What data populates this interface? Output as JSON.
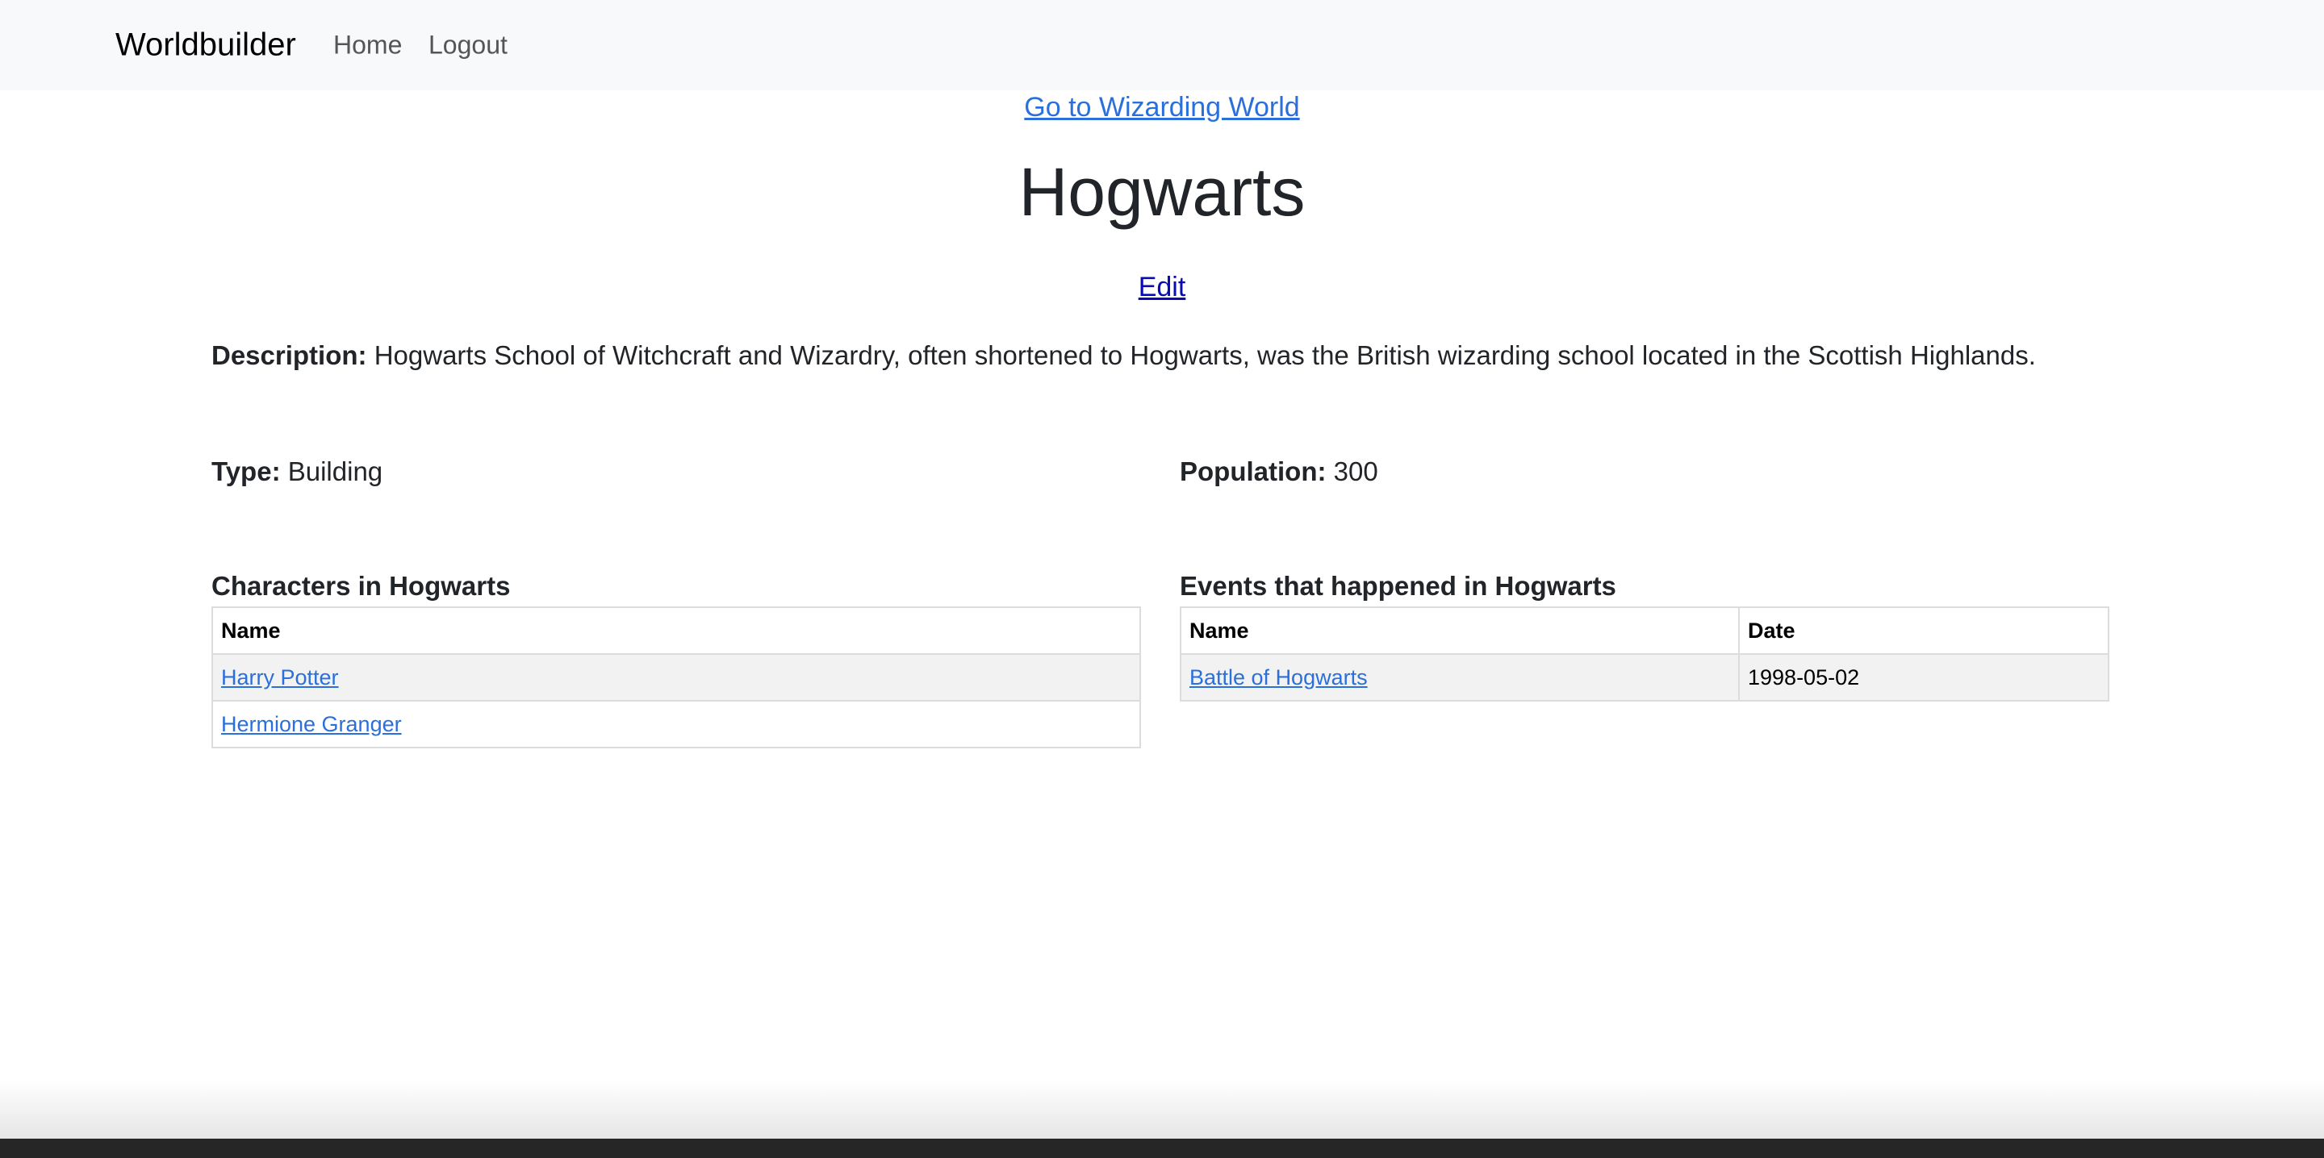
{
  "navbar": {
    "brand": "Worldbuilder",
    "links": [
      {
        "label": "Home"
      },
      {
        "label": "Logout"
      }
    ]
  },
  "location": {
    "world_link": "Go to Wizarding World",
    "title": "Hogwarts",
    "edit_label": "Edit",
    "description_label": "Description:",
    "description": " Hogwarts School of Witchcraft and Wizardry, often shortened to Hogwarts, was the British wizarding school located in the Scottish Highlands.",
    "type_label": "Type:",
    "type": " Building",
    "population_label": "Population:",
    "population": " 300"
  },
  "characters": {
    "heading": "Characters in Hogwarts",
    "columns": [
      "Name"
    ],
    "rows": [
      {
        "name": "Harry Potter"
      },
      {
        "name": "Hermione Granger"
      }
    ]
  },
  "events": {
    "heading": "Events that happened in Hogwarts",
    "columns": [
      "Name",
      "Date"
    ],
    "rows": [
      {
        "name": "Battle of Hogwarts",
        "date": "1998-05-02"
      }
    ]
  }
}
